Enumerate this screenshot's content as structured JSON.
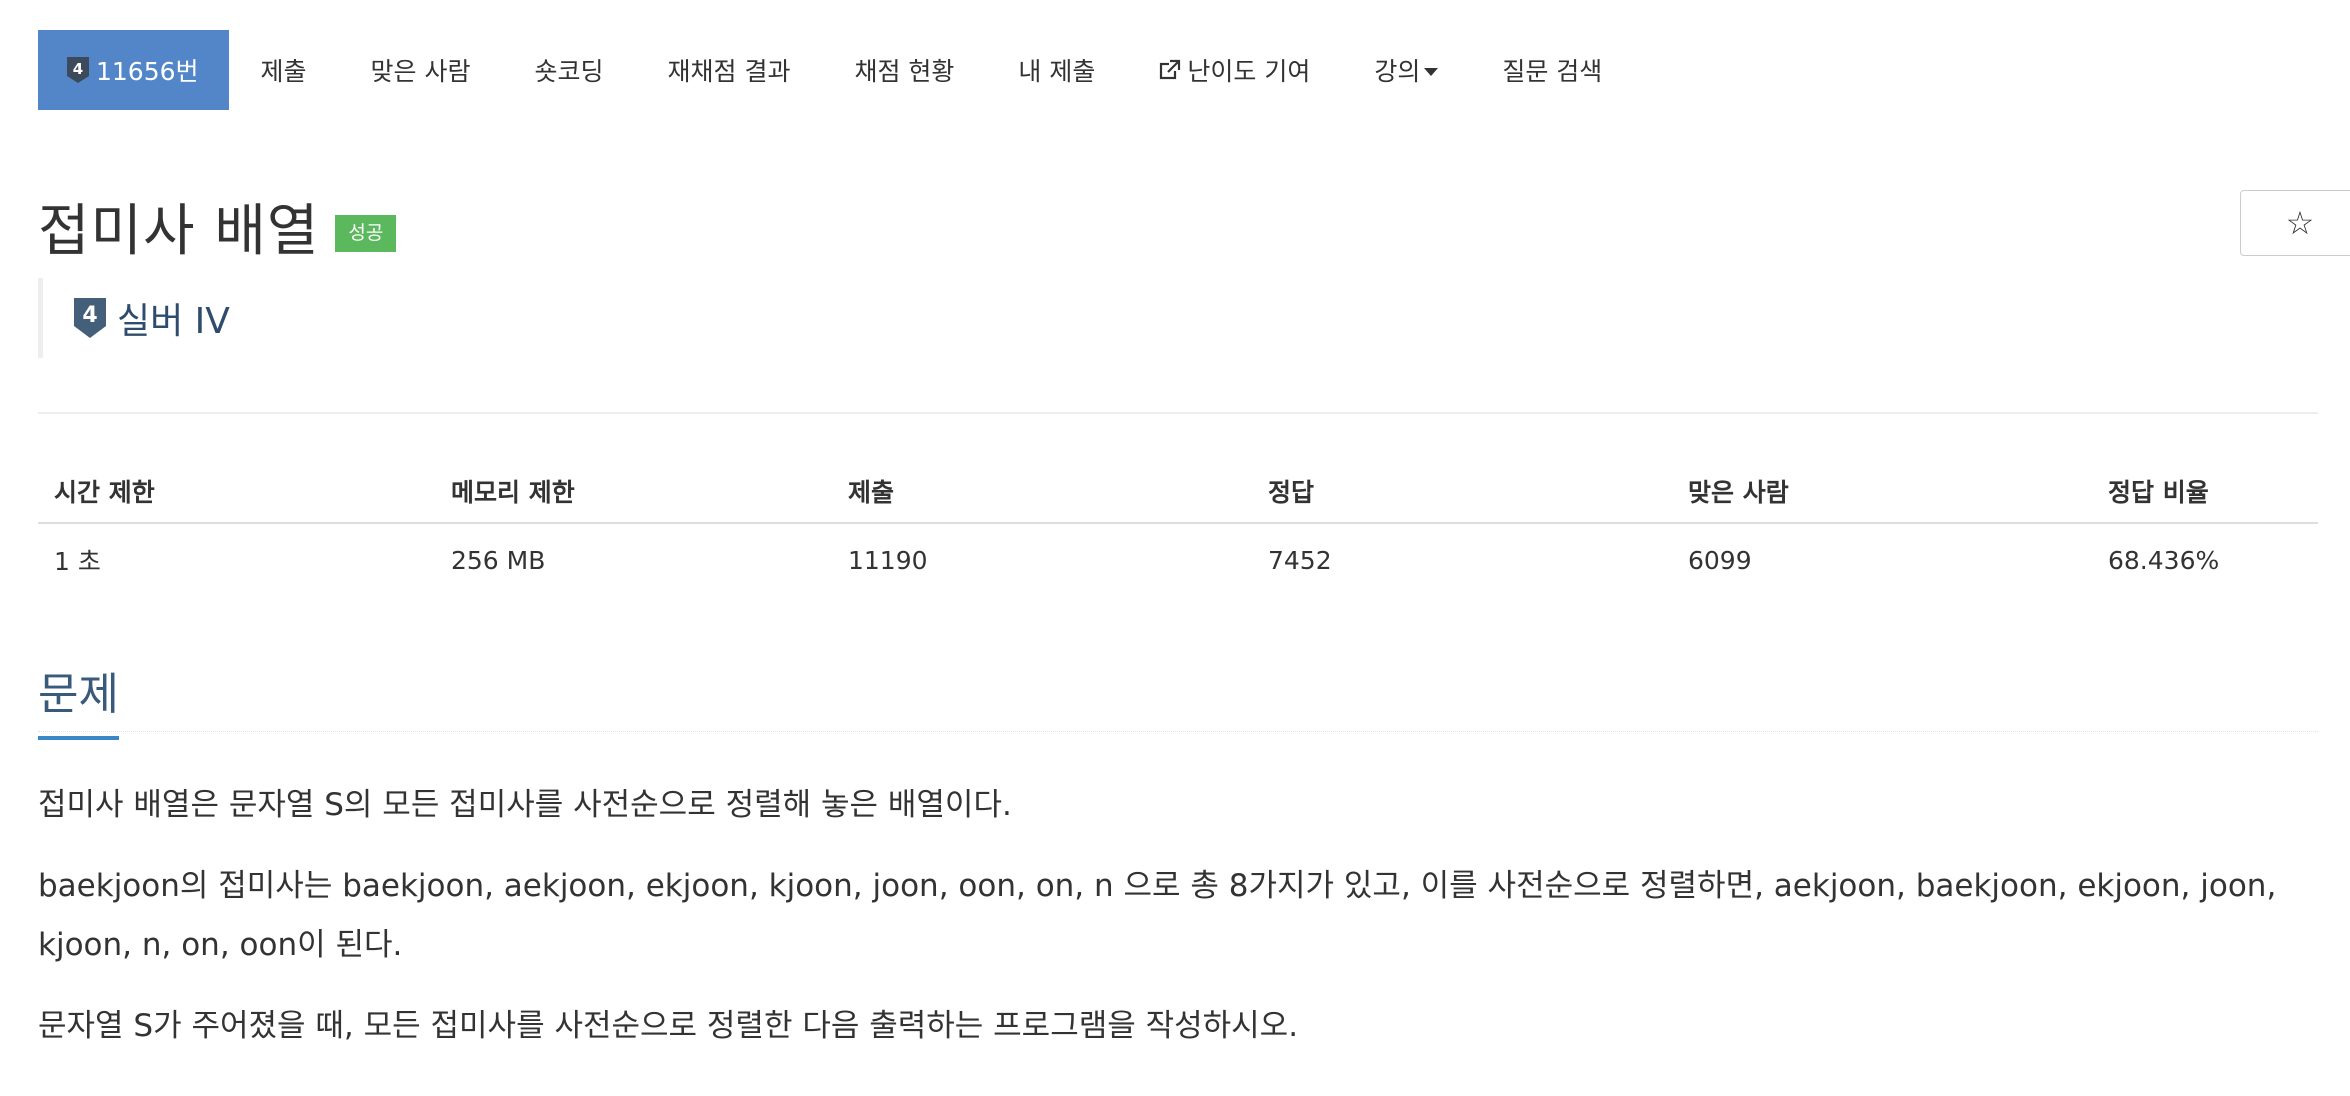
{
  "nav": {
    "problem_number": "11656번",
    "tier_badge_digit": "4",
    "items": [
      {
        "id": "submit",
        "label": "제출"
      },
      {
        "id": "solvers",
        "label": "맞은 사람"
      },
      {
        "id": "shortcoding",
        "label": "숏코딩"
      },
      {
        "id": "rejudge",
        "label": "재채점 결과"
      },
      {
        "id": "grading",
        "label": "채점 현황"
      },
      {
        "id": "my-submissions",
        "label": "내 제출"
      },
      {
        "id": "difficulty",
        "label": "난이도 기여",
        "icon": "external-link-icon"
      },
      {
        "id": "lectures",
        "label": "강의",
        "icon": "caret-down-icon"
      },
      {
        "id": "question-search",
        "label": "질문 검색"
      }
    ]
  },
  "problem": {
    "title": "접미사 배열",
    "result_label": "성공",
    "star_icon": "☆",
    "tier_digit": "4",
    "tier_name": "실버 IV"
  },
  "info": {
    "headers": [
      "시간 제한",
      "메모리 제한",
      "제출",
      "정답",
      "맞은 사람",
      "정답 비율"
    ],
    "values": [
      "1 초",
      "256 MB",
      "11190",
      "7452",
      "6099",
      "68.436%"
    ]
  },
  "section": {
    "title": "문제",
    "paragraphs": [
      "접미사 배열은 문자열 S의 모든 접미사를 사전순으로 정렬해 놓은 배열이다.",
      "baekjoon의 접미사는 baekjoon, aekjoon, ekjoon, kjoon, joon, oon, on, n 으로 총 8가지가 있고, 이를 사전순으로 정렬하면, aekjoon, baekjoon, ekjoon, joon, kjoon, n, on, oon이 된다.",
      "문자열 S가 주어졌을 때, 모든 접미사를 사전순으로 정렬한 다음 출력하는 프로그램을 작성하시오."
    ]
  },
  "colors": {
    "nav_active_bg": "#5286c8",
    "success_label": "#5cb85c",
    "tier_silver_dark": "#435f7a",
    "section_accent": "#3a87c8"
  }
}
